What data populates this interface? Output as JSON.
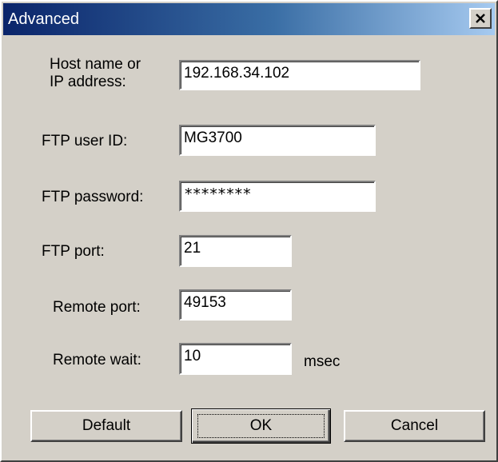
{
  "window": {
    "title": "Advanced",
    "close_icon": "close-x-icon"
  },
  "fields": {
    "host": {
      "label_line1": "Host name or",
      "label_line2": "IP address:",
      "value": "192.168.34.102"
    },
    "ftp_user": {
      "label": "FTP user ID:",
      "value": "MG3700"
    },
    "ftp_password": {
      "label": "FTP password:",
      "value": "********"
    },
    "ftp_port": {
      "label": "FTP port:",
      "value": "21"
    },
    "remote_port": {
      "label": "Remote port:",
      "value": "49153"
    },
    "remote_wait": {
      "label": "Remote wait:",
      "value": "10",
      "unit": "msec"
    }
  },
  "buttons": {
    "default": "Default",
    "ok": "OK",
    "cancel": "Cancel"
  },
  "colors": {
    "dialog_face": "#d4d0c8",
    "title_start": "#0a246a",
    "title_end": "#a6caf0"
  }
}
